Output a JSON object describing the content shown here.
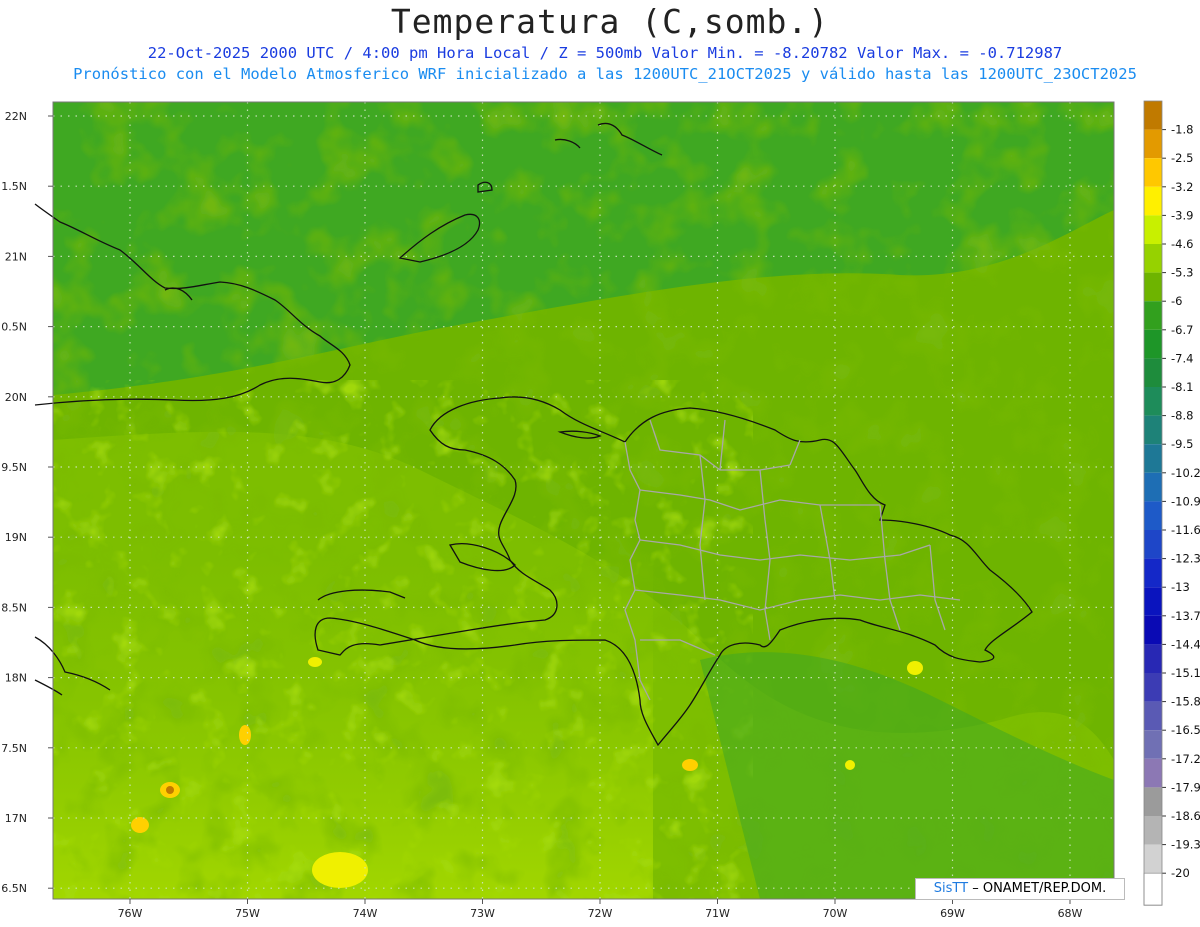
{
  "header": {
    "title": "Temperatura (C,somb.)",
    "subtitle_line1": "22-Oct-2025  2000 UTC / 4:00 pm Hora Local / Z = 500mb  Valor Min. = -8.20782  Valor Max. = -0.712987",
    "subtitle_line2": "Pronóstico con el Modelo Atmosferico WRF inicializado a las 1200UTC_21OCT2025 y válido hasta las  1200UTC_23OCT2025"
  },
  "map": {
    "lat_labels": [
      "22N",
      "1.5N",
      "21N",
      "0.5N",
      "20N",
      "9.5N",
      "19N",
      "8.5N",
      "18N",
      "7.5N",
      "17N",
      "6.5N"
    ],
    "lon_labels": [
      "76W",
      "75W",
      "74W",
      "73W",
      "72W",
      "71W",
      "70W",
      "69W",
      "68W"
    ],
    "base_color": "#3fa822"
  },
  "legend": {
    "levels": [
      {
        "label": "-1.8",
        "color": "#c07a00"
      },
      {
        "label": "-2.5",
        "color": "#e39a00"
      },
      {
        "label": "-3.2",
        "color": "#ffc800"
      },
      {
        "label": "-3.9",
        "color": "#fff000"
      },
      {
        "label": "-4.6",
        "color": "#c8f000"
      },
      {
        "label": "-5.3",
        "color": "#96d200"
      },
      {
        "label": "-6",
        "color": "#6eb400"
      },
      {
        "label": "-6.7",
        "color": "#32a01e"
      },
      {
        "label": "-7.4",
        "color": "#1e9628"
      },
      {
        "label": "-8.1",
        "color": "#1e8c3c"
      },
      {
        "label": "-8.8",
        "color": "#1e8c5a"
      },
      {
        "label": "-9.5",
        "color": "#1e8278"
      },
      {
        "label": "-10.2",
        "color": "#1e7896"
      },
      {
        "label": "-10.9",
        "color": "#1e6eb4"
      },
      {
        "label": "-11.6",
        "color": "#1e5ac8"
      },
      {
        "label": "-12.3",
        "color": "#1e46c8"
      },
      {
        "label": "-13",
        "color": "#1428c8"
      },
      {
        "label": "-13.7",
        "color": "#0a14be"
      },
      {
        "label": "-14.4",
        "color": "#0a0ab4"
      },
      {
        "label": "-15.1",
        "color": "#2828b4"
      },
      {
        "label": "-15.8",
        "color": "#3c3cb4"
      },
      {
        "label": "-16.5",
        "color": "#5a5ab4"
      },
      {
        "label": "-17.2",
        "color": "#7070b4"
      },
      {
        "label": "-17.9",
        "color": "#8c78b4"
      },
      {
        "label": "-18.6",
        "color": "#9b9b9b"
      },
      {
        "label": "-19.3",
        "color": "#b4b4b4"
      },
      {
        "label": "-20",
        "color": "#d2d2d2"
      }
    ],
    "bottom_color": "#ffffff"
  },
  "credit": {
    "logo": "SisTT",
    "text": "– ONAMET/REP.DOM."
  }
}
